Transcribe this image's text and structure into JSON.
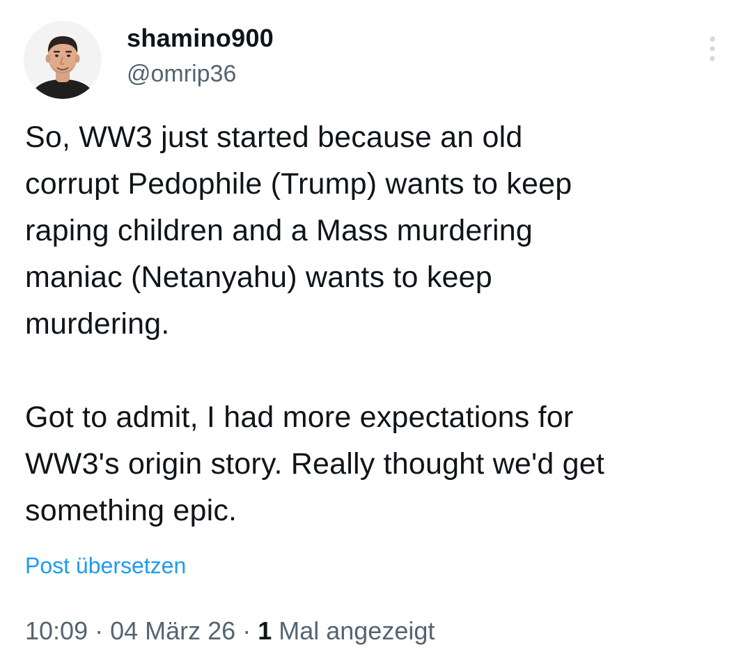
{
  "author": {
    "display_name": "shamino900",
    "handle": "@omrip36"
  },
  "tweet": {
    "paragraphs": [
      [
        "So, WW3 just started because an old",
        "corrupt Pedophile (Trump) wants to keep",
        "raping children and a Mass murdering",
        "maniac (Netanyahu) wants to keep",
        "murdering."
      ],
      [
        "Got to admit, I had more expectations for",
        "WW3's origin story. Really thought we'd get",
        "something epic."
      ]
    ]
  },
  "translate_label": "Post übersetzen",
  "meta": {
    "time": "10:09",
    "separator": " · ",
    "date": "04 März 26",
    "views_count": "1",
    "views_label": " Mal angezeigt"
  },
  "icons": {
    "more": "vertical-ellipsis-icon",
    "avatar": "user-avatar"
  },
  "colors": {
    "text_primary": "#0f1419",
    "text_secondary": "#536471",
    "link": "#1d9bf0"
  }
}
